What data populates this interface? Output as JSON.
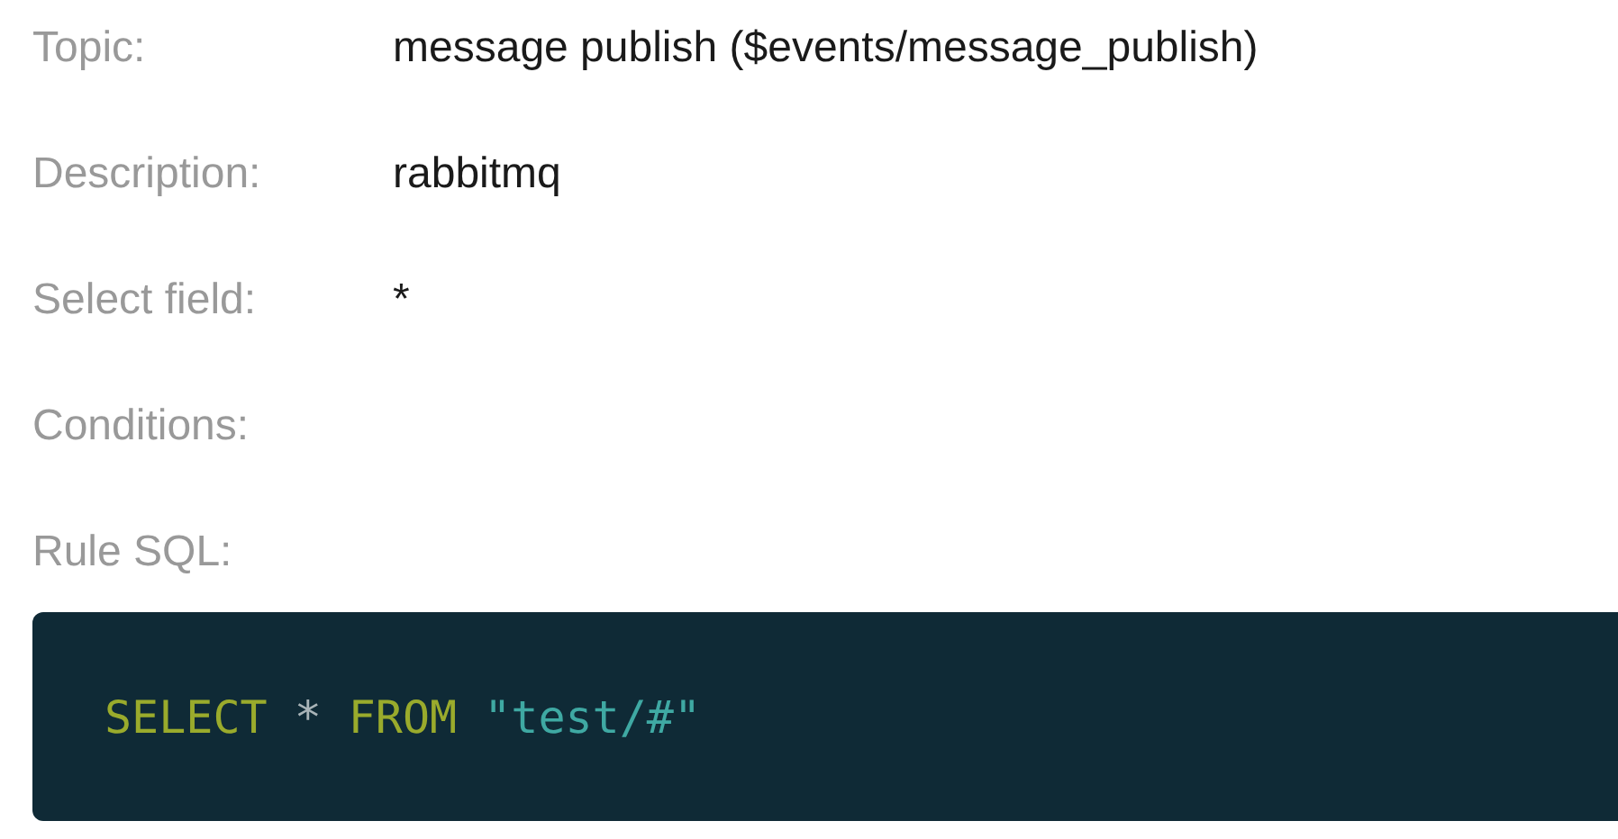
{
  "fields": [
    {
      "label": "Topic:",
      "value": "message publish ($events/message_publish)"
    },
    {
      "label": "Description:",
      "value": "rabbitmq"
    },
    {
      "label": "Select field:",
      "value": "*"
    },
    {
      "label": "Conditions:"
    },
    {
      "label": "Rule SQL:"
    }
  ],
  "rule_sql": {
    "tokens": [
      {
        "kind": "keyword",
        "text": "SELECT"
      },
      {
        "kind": "operator",
        "text": "*"
      },
      {
        "kind": "keyword",
        "text": "FROM"
      },
      {
        "kind": "string",
        "text": "\"test/#\""
      }
    ]
  }
}
